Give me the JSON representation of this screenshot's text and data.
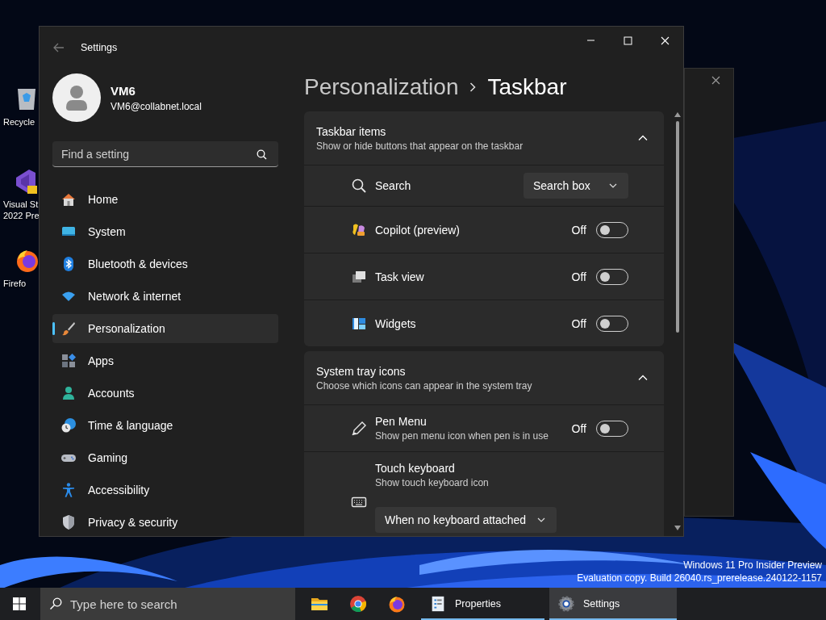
{
  "desktop": {
    "icons": [
      {
        "lines": [
          "Recycle"
        ]
      },
      {
        "lines": [
          "Visual St",
          "2022 Pre"
        ]
      },
      {
        "lines": [
          "Firefo"
        ]
      }
    ],
    "watermark": [
      "Windows 11 Pro Insider Preview",
      "Evaluation copy. Build 26040.rs_prerelease.240122-1157"
    ]
  },
  "window": {
    "title": "Settings",
    "account": {
      "name": "VM6",
      "email": "VM6@collabnet.local"
    },
    "search": {
      "placeholder": "Find a setting"
    },
    "nav": [
      {
        "label": "Home",
        "selected": false
      },
      {
        "label": "System",
        "selected": false
      },
      {
        "label": "Bluetooth & devices",
        "selected": false
      },
      {
        "label": "Network & internet",
        "selected": false
      },
      {
        "label": "Personalization",
        "selected": true
      },
      {
        "label": "Apps",
        "selected": false
      },
      {
        "label": "Accounts",
        "selected": false
      },
      {
        "label": "Time & language",
        "selected": false
      },
      {
        "label": "Gaming",
        "selected": false
      },
      {
        "label": "Accessibility",
        "selected": false
      },
      {
        "label": "Privacy & security",
        "selected": false
      }
    ],
    "breadcrumb": [
      "Personalization",
      "Taskbar"
    ],
    "sections": [
      {
        "title": "Taskbar items",
        "subtitle": "Show or hide buttons that appear on the taskbar",
        "expanded": true,
        "rows": [
          {
            "kind": "dropdown",
            "label": "Search",
            "value": "Search box"
          },
          {
            "kind": "toggle",
            "label": "Copilot (preview)",
            "state_text": "Off",
            "on": false
          },
          {
            "kind": "toggle",
            "label": "Task view",
            "state_text": "Off",
            "on": false
          },
          {
            "kind": "toggle",
            "label": "Widgets",
            "state_text": "Off",
            "on": false
          }
        ]
      },
      {
        "title": "System tray icons",
        "subtitle": "Choose which icons can appear in the system tray",
        "expanded": true,
        "rows": [
          {
            "kind": "toggle",
            "label": "Pen Menu",
            "description": "Show pen menu icon when pen is in use",
            "state_text": "Off",
            "on": false
          },
          {
            "kind": "dropdown_below",
            "label": "Touch keyboard",
            "description": "Show touch keyboard icon",
            "value": "When no keyboard attached"
          }
        ]
      }
    ]
  },
  "taskbar": {
    "search": {
      "placeholder": "Type here to search"
    },
    "apps": [
      {
        "kind": "icon",
        "selected": false,
        "running": false
      },
      {
        "kind": "icon",
        "selected": false,
        "running": false
      },
      {
        "kind": "icon",
        "selected": false,
        "running": false
      },
      {
        "kind": "labeled",
        "label": "Properties",
        "selected": false,
        "running": true
      },
      {
        "kind": "labeled",
        "label": "Settings",
        "selected": true,
        "running": true
      }
    ]
  }
}
